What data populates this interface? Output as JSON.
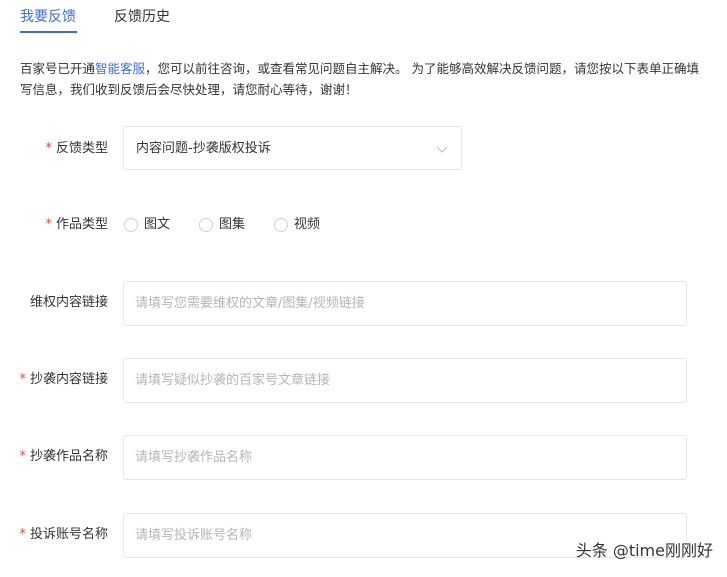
{
  "tabs": [
    {
      "label": "我要反馈",
      "active": true
    },
    {
      "label": "反馈历史",
      "active": false
    }
  ],
  "notice": {
    "text_before": "百家号已开通",
    "link": "智能客服",
    "text_after": "，您可以前往咨询，或查看常见问题自主解决。 为了能够高效解决反馈问题，请您按以下表单正确填写信息，我们收到反馈后会尽快处理，请您耐心等待，谢谢！"
  },
  "form": {
    "required_mark": "*",
    "feedback_type": {
      "label": "反馈类型",
      "value": "内容问题-抄袭版权投诉",
      "icon": "chevron-down-icon"
    },
    "work_type": {
      "label": "作品类型",
      "options": [
        "图文",
        "图集",
        "视频"
      ]
    },
    "rights_link": {
      "label": "维权内容链接",
      "placeholder": "请填写您需要维权的文章/图集/视频链接"
    },
    "plagiarism_link": {
      "label": "抄袭内容链接",
      "placeholder": "请填写疑似抄袭的百家号文章链接"
    },
    "plagiarism_title": {
      "label": "抄袭作品名称",
      "placeholder": "请填写抄袭作品名称"
    },
    "reported_account": {
      "label": "投诉账号名称",
      "placeholder": "请填写投诉账号名称"
    }
  },
  "watermark": "头条 @time刚刚好",
  "colors": {
    "accent": "#3d6ae8",
    "required": "#e8473d",
    "border": "#e6e6e6",
    "placeholder": "#b5b5b5"
  }
}
